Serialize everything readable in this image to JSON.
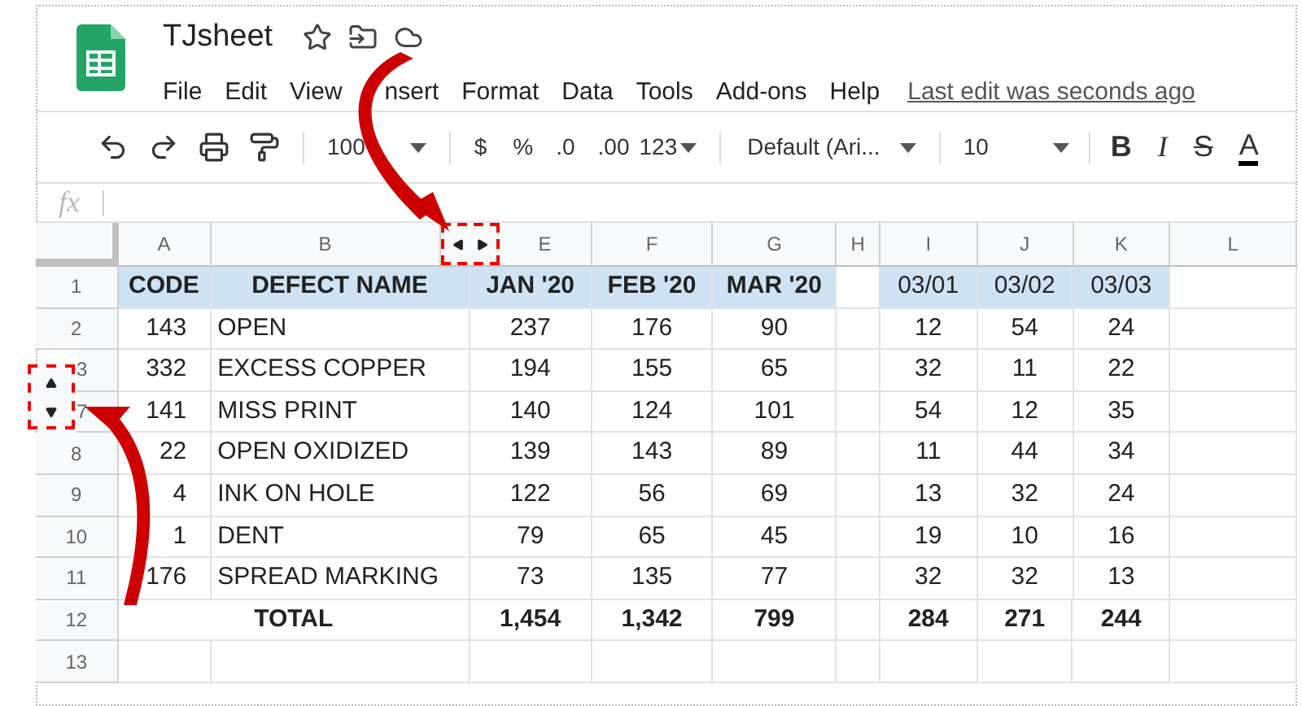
{
  "app": {
    "title": "TJsheet",
    "menu": [
      "File",
      "Edit",
      "View",
      "nsert",
      "Format",
      "Data",
      "Tools",
      "Add-ons",
      "Help"
    ],
    "last_edit": "Last edit was seconds ago"
  },
  "toolbar": {
    "zoom": "100",
    "currency": "$",
    "percent": "%",
    "decrease_decimals": ".0",
    "increase_decimals": ".00",
    "number_format": "123",
    "font": "Default (Ari...",
    "font_size": "10",
    "bold": "B",
    "italic": "I",
    "strikethrough": "S",
    "text_color": "A"
  },
  "formula_bar": {
    "label": "fx"
  },
  "columns": [
    "A",
    "B",
    "E",
    "F",
    "G",
    "H",
    "I",
    "J",
    "K",
    "L"
  ],
  "rows": [
    {
      "number": "1",
      "kind": "header",
      "cells": [
        "CODE",
        "DEFECT NAME",
        "JAN '20",
        "FEB '20",
        "MAR '20",
        "",
        "03/01",
        "03/02",
        "03/03"
      ]
    },
    {
      "number": "2",
      "kind": "data",
      "cells": [
        "143",
        "OPEN",
        "237",
        "176",
        "90",
        "",
        "12",
        "54",
        "24"
      ]
    },
    {
      "number": "3",
      "kind": "data",
      "cells": [
        "332",
        "EXCESS COPPER",
        "194",
        "155",
        "65",
        "",
        "32",
        "11",
        "22"
      ]
    },
    {
      "number": "7",
      "kind": "data",
      "cells": [
        "141",
        "MISS PRINT",
        "140",
        "124",
        "101",
        "",
        "54",
        "12",
        "35"
      ]
    },
    {
      "number": "8",
      "kind": "data",
      "cells": [
        "22",
        "OPEN OXIDIZED",
        "139",
        "143",
        "89",
        "",
        "11",
        "44",
        "34"
      ]
    },
    {
      "number": "9",
      "kind": "data",
      "cells": [
        "4",
        "INK ON HOLE",
        "122",
        "56",
        "69",
        "",
        "13",
        "32",
        "24"
      ]
    },
    {
      "number": "10",
      "kind": "data",
      "cells": [
        "1",
        "DENT",
        "79",
        "65",
        "45",
        "",
        "19",
        "10",
        "16"
      ]
    },
    {
      "number": "11",
      "kind": "data",
      "cells": [
        "176",
        "SPREAD MARKING",
        "73",
        "135",
        "77",
        "",
        "32",
        "32",
        "13"
      ]
    },
    {
      "number": "12",
      "kind": "total",
      "cells": [
        "TOTAL",
        "1,454",
        "1,342",
        "799",
        "",
        "284",
        "271",
        "244"
      ]
    },
    {
      "number": "13",
      "kind": "empty",
      "cells": []
    }
  ]
}
